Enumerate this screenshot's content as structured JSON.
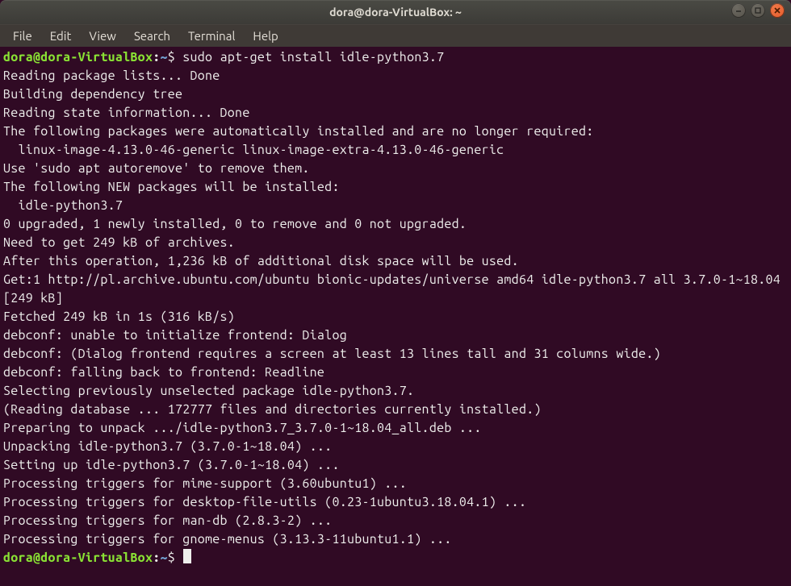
{
  "window": {
    "title": "dora@dora-VirtualBox: ~"
  },
  "menubar": {
    "file": "File",
    "edit": "Edit",
    "view": "View",
    "search": "Search",
    "terminal": "Terminal",
    "help": "Help"
  },
  "prompt": {
    "user_host": "dora@dora-VirtualBox",
    "colon": ":",
    "path": "~",
    "symbol": "$"
  },
  "command": "sudo apt-get install idle-python3.7",
  "output_lines": [
    "Reading package lists... Done",
    "Building dependency tree",
    "Reading state information... Done",
    "The following packages were automatically installed and are no longer required:",
    "  linux-image-4.13.0-46-generic linux-image-extra-4.13.0-46-generic",
    "Use 'sudo apt autoremove' to remove them.",
    "The following NEW packages will be installed:",
    "  idle-python3.7",
    "0 upgraded, 1 newly installed, 0 to remove and 0 not upgraded.",
    "Need to get 249 kB of archives.",
    "After this operation, 1,236 kB of additional disk space will be used.",
    "Get:1 http://pl.archive.ubuntu.com/ubuntu bionic-updates/universe amd64 idle-python3.7 all 3.7.0-1~18.04 [249 kB]",
    "Fetched 249 kB in 1s (316 kB/s)",
    "debconf: unable to initialize frontend: Dialog",
    "debconf: (Dialog frontend requires a screen at least 13 lines tall and 31 columns wide.)",
    "debconf: falling back to frontend: Readline",
    "Selecting previously unselected package idle-python3.7.",
    "(Reading database ... 172777 files and directories currently installed.)",
    "Preparing to unpack .../idle-python3.7_3.7.0-1~18.04_all.deb ...",
    "Unpacking idle-python3.7 (3.7.0-1~18.04) ...",
    "Setting up idle-python3.7 (3.7.0-1~18.04) ...",
    "Processing triggers for mime-support (3.60ubuntu1) ...",
    "Processing triggers for desktop-file-utils (0.23-1ubuntu3.18.04.1) ...",
    "Processing triggers for man-db (2.8.3-2) ...",
    "Processing triggers for gnome-menus (3.13.3-11ubuntu1.1) ..."
  ]
}
